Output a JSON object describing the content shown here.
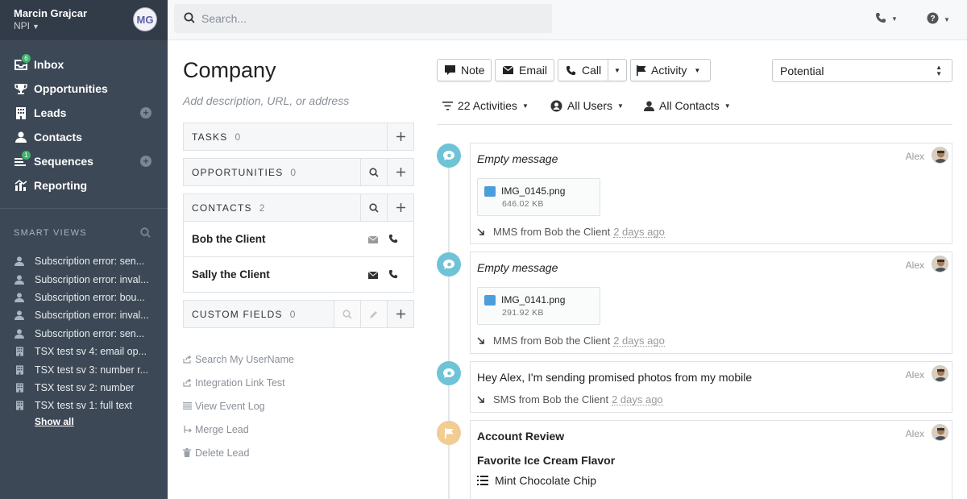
{
  "user": {
    "name": "Marcin Grajcar",
    "org": "NPI",
    "initials": "MG"
  },
  "nav": [
    {
      "label": "Inbox",
      "icon": "inbox-icon",
      "badge": "6"
    },
    {
      "label": "Opportunities",
      "icon": "trophy-icon"
    },
    {
      "label": "Leads",
      "icon": "building-icon",
      "add": "+"
    },
    {
      "label": "Contacts",
      "icon": "person-icon"
    },
    {
      "label": "Sequences",
      "icon": "sequences-icon",
      "badge": "1",
      "add": "+"
    },
    {
      "label": "Reporting",
      "icon": "chart-icon"
    }
  ],
  "smart_views": {
    "title": "SMART VIEWS",
    "items": [
      {
        "label": "Subscription error: sen...",
        "icon": "person-icon"
      },
      {
        "label": "Subscription error: inval...",
        "icon": "person-icon"
      },
      {
        "label": "Subscription error: bou...",
        "icon": "person-icon"
      },
      {
        "label": "Subscription error: inval...",
        "icon": "person-icon"
      },
      {
        "label": "Subscription error: sen...",
        "icon": "person-icon"
      },
      {
        "label": "TSX test sv 4: email op...",
        "icon": "building-icon"
      },
      {
        "label": "TSX test sv 3: number r...",
        "icon": "building-icon"
      },
      {
        "label": "TSX test sv 2: number",
        "icon": "building-icon"
      },
      {
        "label": "TSX test sv 1: full text",
        "icon": "building-icon"
      }
    ],
    "show_all": "Show all"
  },
  "search": {
    "placeholder": "Search..."
  },
  "company": {
    "title": "Company",
    "description_placeholder": "Add description, URL, or address"
  },
  "panels": {
    "tasks": {
      "label": "TASKS",
      "count": "0"
    },
    "opportunities": {
      "label": "OPPORTUNITIES",
      "count": "0"
    },
    "contacts": {
      "label": "CONTACTS",
      "count": "2",
      "items": [
        {
          "name": "Bob the Client"
        },
        {
          "name": "Sally the Client"
        }
      ]
    },
    "custom_fields": {
      "label": "CUSTOM FIELDS",
      "count": "0"
    }
  },
  "links": [
    {
      "label": "Search My UserName",
      "icon": "share-icon"
    },
    {
      "label": "Integration Link Test",
      "icon": "share-icon"
    },
    {
      "label": "View Event Log",
      "icon": "list-icon"
    },
    {
      "label": "Merge Lead",
      "icon": "merge-icon"
    },
    {
      "label": "Delete Lead",
      "icon": "trash-icon"
    }
  ],
  "toolbar": {
    "note": "Note",
    "email": "Email",
    "call": "Call",
    "activity": "Activity"
  },
  "status": {
    "value": "Potential"
  },
  "filters": {
    "activities": "22 Activities",
    "users": "All Users",
    "contacts": "All Contacts"
  },
  "feed": [
    {
      "type": "mms",
      "title": "Empty message",
      "author": "Alex",
      "attachment": {
        "name": "IMG_0145.png",
        "size": "646.02 KB"
      },
      "meta": "MMS from Bob the Client",
      "ago": "2 days ago"
    },
    {
      "type": "mms",
      "title": "Empty message",
      "author": "Alex",
      "attachment": {
        "name": "IMG_0141.png",
        "size": "291.92 KB"
      },
      "meta": "MMS from Bob the Client",
      "ago": "2 days ago"
    },
    {
      "type": "sms",
      "title": "Hey Alex, I'm sending promised photos from my mobile",
      "author": "Alex",
      "meta": "SMS from Bob the Client",
      "ago": "2 days ago"
    },
    {
      "type": "custom",
      "title": "Account Review",
      "author": "Alex",
      "field_label": "Favorite Ice Cream Flavor",
      "field_value": "Mint Chocolate Chip"
    }
  ],
  "colors": {
    "sidebar": "#3d4856",
    "badge": "#3fb36c",
    "message_dot": "#6fc3d6",
    "activity_dot": "#f1cd93"
  }
}
